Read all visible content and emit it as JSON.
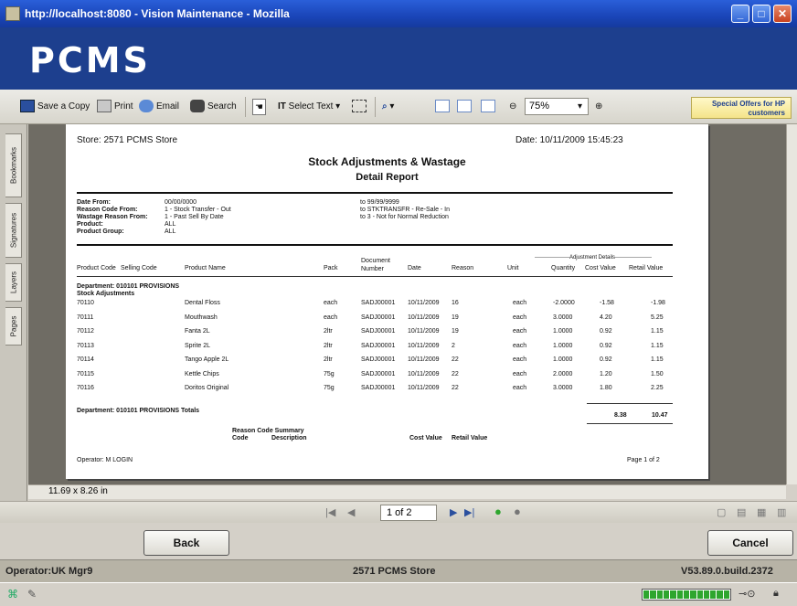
{
  "window": {
    "title": "http://localhost:8080 - Vision Maintenance - Mozilla"
  },
  "brand": {
    "logo": "PCMS"
  },
  "toolbar": {
    "save_copy": "Save a Copy",
    "print": "Print",
    "email": "Email",
    "search": "Search",
    "select_text": "Select Text",
    "zoom": "75%",
    "offers": "Special Offers for HP customers"
  },
  "side_tabs": [
    "Bookmarks",
    "Signatures",
    "Layers",
    "Pages"
  ],
  "report": {
    "store": "Store: 2571 PCMS Store",
    "date": "Date: 10/11/2009 15:45:23",
    "title": "Stock Adjustments & Wastage",
    "subtitle": "Detail Report",
    "criteria": [
      {
        "label": "Date From:",
        "from": "00/00/0000",
        "to": "to 99/99/9999"
      },
      {
        "label": "Reason Code From:",
        "from": "1 - Stock Transfer - Out",
        "to": "to STKTRANSFR - Re-Sale - In"
      },
      {
        "label": "Wastage Reason From:",
        "from": "1 - Past Sell By Date",
        "to": "to 3 - Not for Normal Reduction"
      },
      {
        "label": "Product:",
        "from": "ALL",
        "to": ""
      },
      {
        "label": "Product Group:",
        "from": "ALL",
        "to": ""
      }
    ],
    "adj_details_header": "Adjustment Details",
    "columns": {
      "product_code": "Product Code",
      "selling_code": "Selling Code",
      "product_name": "Product Name",
      "pack": "Pack",
      "doc_number": "Document Number",
      "date": "Date",
      "reason": "Reason",
      "unit": "Unit",
      "quantity": "Quantity",
      "cost_value": "Cost Value",
      "retail_value": "Retail Value"
    },
    "department": "Department: 010101 PROVISIONS",
    "section": "Stock Adjustments",
    "rows": [
      {
        "code": "70110",
        "name": "Dental Floss",
        "pack": "each",
        "doc": "SADJ00001",
        "date": "10/11/2009",
        "reason": "16",
        "unit": "each",
        "qty": "-2.0000",
        "cost": "-1.58",
        "retail": "-1.98"
      },
      {
        "code": "70111",
        "name": "Mouthwash",
        "pack": "each",
        "doc": "SADJ00001",
        "date": "10/11/2009",
        "reason": "19",
        "unit": "each",
        "qty": "3.0000",
        "cost": "4.20",
        "retail": "5.25"
      },
      {
        "code": "70112",
        "name": "Fanta 2L",
        "pack": "2ltr",
        "doc": "SADJ00001",
        "date": "10/11/2009",
        "reason": "19",
        "unit": "each",
        "qty": "1.0000",
        "cost": "0.92",
        "retail": "1.15"
      },
      {
        "code": "70113",
        "name": "Sprite 2L",
        "pack": "2ltr",
        "doc": "SADJ00001",
        "date": "10/11/2009",
        "reason": "2",
        "unit": "each",
        "qty": "1.0000",
        "cost": "0.92",
        "retail": "1.15"
      },
      {
        "code": "70114",
        "name": "Tango Apple 2L",
        "pack": "2ltr",
        "doc": "SADJ00001",
        "date": "10/11/2009",
        "reason": "22",
        "unit": "each",
        "qty": "1.0000",
        "cost": "0.92",
        "retail": "1.15"
      },
      {
        "code": "70115",
        "name": "Kettle Chips",
        "pack": "75g",
        "doc": "SADJ00001",
        "date": "10/11/2009",
        "reason": "22",
        "unit": "each",
        "qty": "2.0000",
        "cost": "1.20",
        "retail": "1.50"
      },
      {
        "code": "70116",
        "name": "Doritos Original",
        "pack": "75g",
        "doc": "SADJ00001",
        "date": "10/11/2009",
        "reason": "22",
        "unit": "each",
        "qty": "3.0000",
        "cost": "1.80",
        "retail": "2.25"
      }
    ],
    "dept_totals_label": "Department: 010101 PROVISIONS Totals",
    "total_cost": "8.38",
    "total_retail": "10.47",
    "summary_title": "Reason Code Summary",
    "summary_code": "Code",
    "summary_desc": "Description",
    "summary_cost": "Cost Value",
    "summary_retail": "Retail Value",
    "operator": "Operator: M LOGIN",
    "page_of": "Page 1 of 2"
  },
  "page_size": "11.69 x 8.26 in",
  "pager": {
    "current": "1 of 2"
  },
  "buttons": {
    "back": "Back",
    "cancel": "Cancel"
  },
  "status": {
    "operator": "Operator:UK Mgr9",
    "store": "2571 PCMS Store",
    "version": "V53.89.0.build.2372"
  }
}
